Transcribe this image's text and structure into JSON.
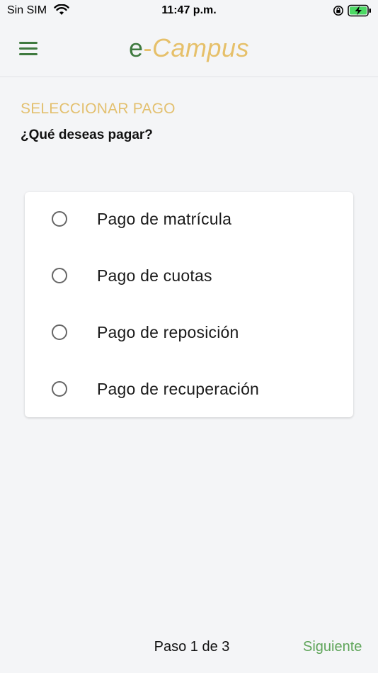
{
  "status_bar": {
    "carrier": "Sin SIM",
    "time": "11:47 p.m.",
    "wifi_icon": "wifi-icon",
    "rotation_icon": "rotation-lock-icon",
    "battery_icon": "battery-charging-icon"
  },
  "header": {
    "menu_icon": "hamburger-menu-icon",
    "brand": {
      "prefix": "e",
      "dash": "-",
      "name": "Campus"
    }
  },
  "main": {
    "section_title": "SELECCIONAR PAGO",
    "question": "¿Qué deseas pagar?",
    "options": [
      {
        "label": "Pago de matrícula",
        "selected": false
      },
      {
        "label": "Pago de cuotas",
        "selected": false
      },
      {
        "label": "Pago de reposición",
        "selected": false
      },
      {
        "label": "Pago de recuperación",
        "selected": false
      }
    ]
  },
  "footer": {
    "step": "Paso 1 de 3",
    "next_label": "Siguiente"
  },
  "colors": {
    "brand_green": "#3f7a3f",
    "brand_gold": "#e6c06a",
    "action_green": "#5fa55a",
    "background": "#f4f5f7"
  }
}
